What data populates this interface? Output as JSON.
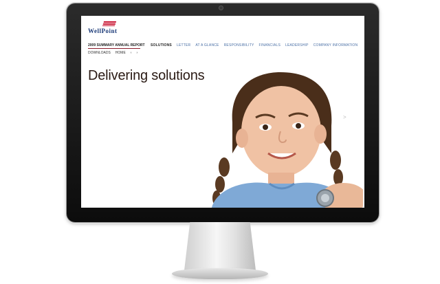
{
  "site": {
    "logo_text": "WellPoint",
    "report_title": "2009 SUMMARY ANNUAL REPORT",
    "nav": [
      "SOLUTIONS",
      "LETTER",
      "AT A GLANCE",
      "RESPONSIBILITY",
      "FINANCIALS",
      "LEADERSHIP",
      "COMPANY INFORMATION"
    ],
    "subnav": {
      "downloads": "DOWNLOADS",
      "home": "HOME",
      "prev": "‹",
      "next": "›"
    },
    "headline": "Delivering solutions",
    "slide_arrow": ">"
  },
  "colors": {
    "brand_red": "#c8102e",
    "brand_blue": "#1b3a78",
    "nav_link": "#4a6fa5"
  },
  "icons": [
    "wellpoint-logo-icon",
    "slide-next-icon"
  ]
}
